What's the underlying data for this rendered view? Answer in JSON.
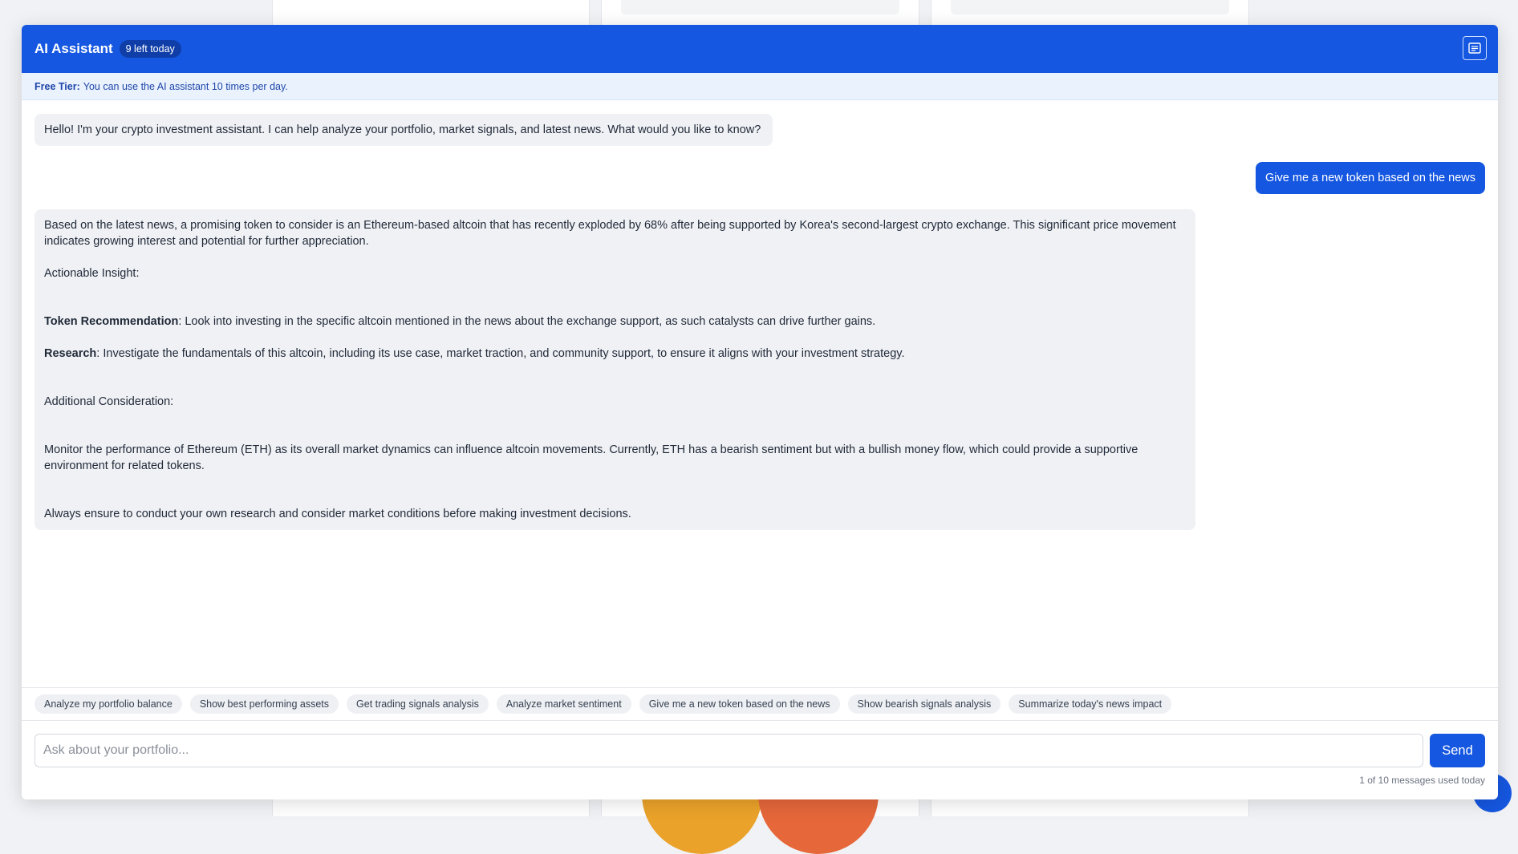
{
  "header": {
    "title": "AI Assistant",
    "badge": "9 left today",
    "menu_icon": "list-icon"
  },
  "tier": {
    "label": "Free Tier:",
    "text": "You can use the AI assistant 10 times per day."
  },
  "messages": {
    "greeting": "Hello! I'm your crypto investment assistant. I can help analyze your portfolio, market signals, and latest news. What would you like to know?",
    "user_query": "Give me a new token based on the news",
    "reply": {
      "intro": "Based on the latest news, a promising token to consider is an Ethereum-based altcoin that has recently exploded by 68% after being supported by Korea's second-largest crypto exchange. This significant price movement indicates growing interest and potential for further appreciation.",
      "insight_heading": "Actionable Insight:",
      "token_label": "Token Recommendation",
      "token_text": ": Look into investing in the specific altcoin mentioned in the news about the exchange support, as such catalysts can drive further gains.",
      "research_label": "Research",
      "research_text": ": Investigate the fundamentals of this altcoin, including its use case, market traction, and community support, to ensure it aligns with your investment strategy.",
      "consideration_heading": "Additional Consideration:",
      "consideration_text": "Monitor the performance of Ethereum (ETH) as its overall market dynamics can influence altcoin movements. Currently, ETH has a bearish sentiment but with a bullish money flow, which could provide a supportive environment for related tokens.",
      "closing": "Always ensure to conduct your own research and consider market conditions before making investment decisions."
    }
  },
  "suggestions": [
    "Analyze my portfolio balance",
    "Show best performing assets",
    "Get trading signals analysis",
    "Analyze market sentiment",
    "Give me a new token based on the news",
    "Show bearish signals analysis",
    "Summarize today's news impact"
  ],
  "input": {
    "placeholder": "Ask about your portfolio...",
    "value": ""
  },
  "send_label": "Send",
  "usage": "1 of 10 messages used today",
  "colors": {
    "primary": "#1557e0",
    "tier_bg": "#eaf2fe",
    "bubble_ai": "#f0f1f5"
  }
}
